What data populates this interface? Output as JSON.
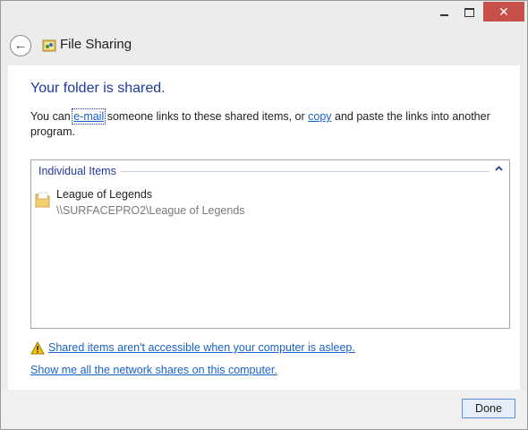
{
  "window": {
    "title": "File Sharing",
    "icon": "file-sharing-icon",
    "close_color": "#c7504a"
  },
  "content": {
    "heading": "Your folder is shared.",
    "description": {
      "prefix": "You can ",
      "email_link": "e-mail",
      "middle": " someone links to these shared items, or ",
      "copy_link": "copy",
      "suffix": " and paste the links into another program."
    },
    "group": {
      "label": "Individual Items",
      "expanded": true
    },
    "items": [
      {
        "name": "League of Legends",
        "path": "\\\\SURFACEPRO2\\League of Legends",
        "icon": "folder-icon"
      }
    ],
    "warning_link": "Shared items aren't accessible when your computer is asleep.",
    "shares_link": "Show me all the network shares on this computer."
  },
  "footer": {
    "done_label": "Done"
  },
  "colors": {
    "heading": "#1f3b9b",
    "link": "#1a62c9",
    "path_text": "#7a7a7a",
    "button_border": "#5a8ddb"
  }
}
